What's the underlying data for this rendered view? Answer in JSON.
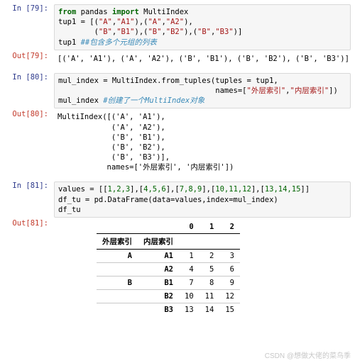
{
  "cells": {
    "in79_prompt": "In [79]:",
    "out79_prompt": "Out[79]:",
    "in80_prompt": "In [80]:",
    "out80_prompt": "Out[80]:",
    "in81_prompt": "In [81]:",
    "out81_prompt": "Out[81]:"
  },
  "in79": {
    "l1a": "from",
    "l1b": " pandas ",
    "l1c": "import",
    "l1d": " MultiIndex",
    "l2a": "tup1 = [(",
    "l2b": "\"A\"",
    "l2c": ",",
    "l2d": "\"A1\"",
    "l2e": "),(",
    "l2f": "\"A\"",
    "l2g": ",",
    "l2h": "\"A2\"",
    "l2i": "),",
    "l3a": "        (",
    "l3b": "\"B\"",
    "l3c": ",",
    "l3d": "\"B1\"",
    "l3e": "),(",
    "l3f": "\"B\"",
    "l3g": ",",
    "l3h": "\"B2\"",
    "l3i": "),(",
    "l3j": "\"B\"",
    "l3k": ",",
    "l3l": "\"B3\"",
    "l3m": ")]",
    "l4a": "tup1 ",
    "l4b": "##包含多个元组的列表"
  },
  "out79": "[('A', 'A1'), ('A', 'A2'), ('B', 'B1'), ('B', 'B2'), ('B', 'B3')]",
  "in80": {
    "l1": "mul_index = MultiIndex.from_tuples(tuples = tup1,",
    "l2a": "                                   names=[",
    "l2b": "\"外层索引\"",
    "l2c": ",",
    "l2d": "\"内层索引\"",
    "l2e": "])",
    "l3a": "mul_index ",
    "l3b": "#创建了一个MultiIndex对象"
  },
  "out80": "MultiIndex([('A', 'A1'),\n            ('A', 'A2'),\n            ('B', 'B1'),\n            ('B', 'B2'),\n            ('B', 'B3')],\n           names=['外层索引', '内层索引'])",
  "in81": {
    "l1a": "values = [[",
    "l1b": "1,2,3",
    "l1c": "],[",
    "l1d": "4,5,6",
    "l1e": "],[",
    "l1f": "7,8,9",
    "l1g": "],[",
    "l1h": "10,11,12",
    "l1i": "],[",
    "l1j": "13,14,15",
    "l1k": "]]",
    "l2": "df_tu = pd.DataFrame(data=values,index=mul_index)",
    "l3": "df_tu"
  },
  "df": {
    "idx0_name": "外层索引",
    "idx1_name": "内层索引",
    "cols": [
      "0",
      "1",
      "2"
    ],
    "rows": [
      {
        "i0": "A",
        "i1": "A1",
        "v": [
          "1",
          "2",
          "3"
        ]
      },
      {
        "i0": "",
        "i1": "A2",
        "v": [
          "4",
          "5",
          "6"
        ]
      },
      {
        "i0": "B",
        "i1": "B1",
        "v": [
          "7",
          "8",
          "9"
        ]
      },
      {
        "i0": "",
        "i1": "B2",
        "v": [
          "10",
          "11",
          "12"
        ]
      },
      {
        "i0": "",
        "i1": "B3",
        "v": [
          "13",
          "14",
          "15"
        ]
      }
    ]
  },
  "watermark": "CSDN @想做大佬的菜鸟季"
}
